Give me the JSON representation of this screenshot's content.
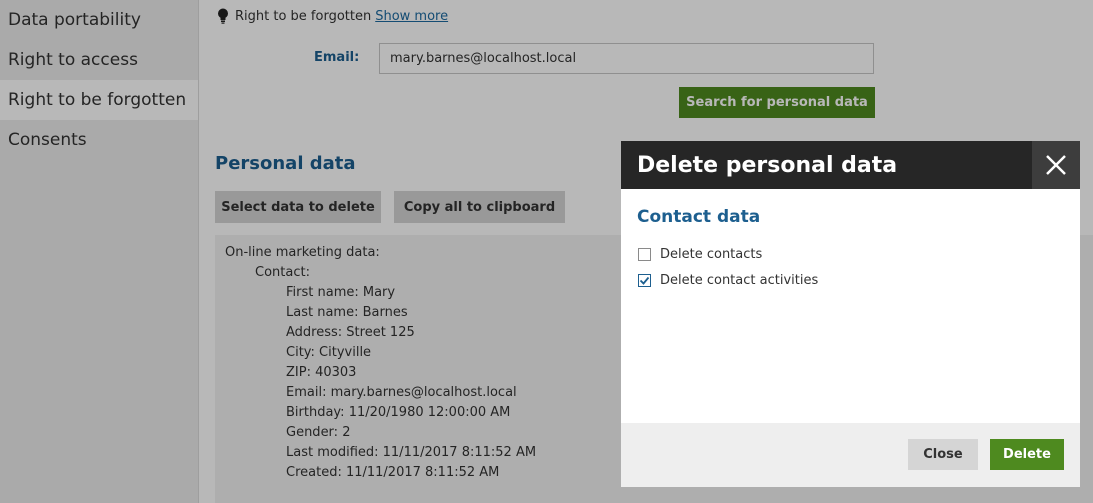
{
  "sidebar": {
    "items": [
      {
        "label": "Data portability"
      },
      {
        "label": "Right to access"
      },
      {
        "label": "Right to be forgotten"
      },
      {
        "label": "Consents"
      }
    ],
    "active_index": 2
  },
  "main": {
    "hint_text": "Right to be forgotten",
    "show_more": "Show more",
    "email_label": "Email:",
    "email_value": "mary.barnes@localhost.local",
    "search_button": "Search for personal data",
    "section_title": "Personal data",
    "select_button": "Select data to delete",
    "copy_button": "Copy all to clipboard",
    "data_lines": [
      {
        "text": "On-line marketing data:",
        "level": 0
      },
      {
        "text": "Contact:",
        "level": 1
      },
      {
        "text": "First name: Mary",
        "level": 2
      },
      {
        "text": "Last name: Barnes",
        "level": 2
      },
      {
        "text": "Address: Street 125",
        "level": 2
      },
      {
        "text": "City: Cityville",
        "level": 2
      },
      {
        "text": "ZIP: 40303",
        "level": 2
      },
      {
        "text": "Email: mary.barnes@localhost.local",
        "level": 2
      },
      {
        "text": "Birthday: 11/20/1980 12:00:00 AM",
        "level": 2
      },
      {
        "text": "Gender: 2",
        "level": 2
      },
      {
        "text": "Last modified: 11/11/2017 8:11:52 AM",
        "level": 2
      },
      {
        "text": "Created: 11/11/2017 8:11:52 AM",
        "level": 2
      }
    ]
  },
  "modal": {
    "title": "Delete personal data",
    "section_title": "Contact data",
    "options": [
      {
        "label": "Delete contacts",
        "checked": false
      },
      {
        "label": "Delete contact activities",
        "checked": true
      }
    ],
    "close_button": "Close",
    "delete_button": "Delete"
  },
  "colors": {
    "accent_blue": "#1d5f8f",
    "primary_green": "#4e8a1f",
    "modal_header": "#262626",
    "overlay": "rgba(0,0,0,0.28)"
  },
  "icons": {
    "hint": "lightbulb-icon",
    "close": "close-icon",
    "check": "checkmark-icon"
  }
}
